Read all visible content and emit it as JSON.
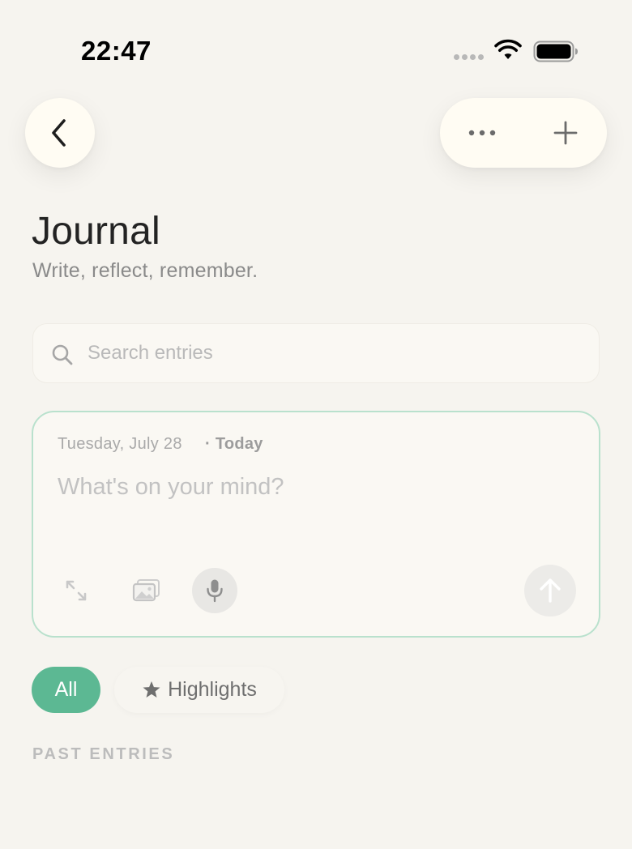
{
  "status_bar": {
    "time": "22:47",
    "signal_icon": "cellular-dots",
    "wifi_icon": "wifi",
    "battery_icon": "battery-full"
  },
  "nav": {
    "back_icon": "chevron-left",
    "more_icon": "ellipsis",
    "add_icon": "plus"
  },
  "header": {
    "title": "Journal",
    "subtitle": "Write, reflect, remember."
  },
  "search": {
    "placeholder": "Search entries",
    "value": "",
    "icon": "magnifier"
  },
  "composer": {
    "date": "Tuesday, July 28",
    "today_label": "· Today",
    "placeholder": "What's on your mind?",
    "value": "",
    "tools": [
      "expand",
      "photo",
      "microphone"
    ],
    "send_icon": "arrow-up"
  },
  "filters": {
    "items": [
      {
        "label": "All",
        "active": true
      },
      {
        "label": "Highlights",
        "active": false,
        "icon": "star"
      }
    ]
  },
  "sections": {
    "past_entries": "PAST ENTRIES"
  },
  "colors": {
    "background": "#f6f4ef",
    "accent": "#5cb893",
    "composer_border": "#b9e1cd",
    "surface": "#fffcf3"
  }
}
